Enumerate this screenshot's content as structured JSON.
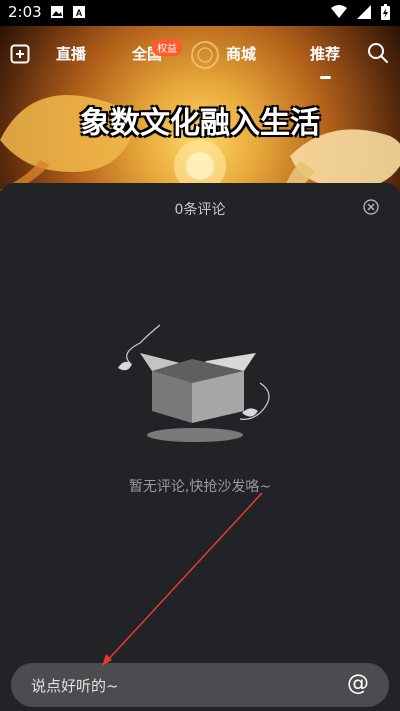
{
  "status_bar": {
    "time": "2:03",
    "icons": [
      "image-icon",
      "a-box-icon"
    ],
    "right_icons": [
      "wifi-icon",
      "signal-icon",
      "battery-charging-icon"
    ]
  },
  "top_nav": {
    "add_icon": "plus-square-icon",
    "tabs": [
      {
        "label": "直播"
      },
      {
        "label": "全国",
        "badge": "权益"
      },
      {
        "label": "商城"
      },
      {
        "label": "推荐",
        "active": true
      }
    ],
    "search_icon": "search-icon"
  },
  "banner": {
    "title": "象数文化融入生活"
  },
  "comments": {
    "title": "0条评论",
    "empty_text": "暂无评论,快抢沙发咯~",
    "input_placeholder": "说点好听的~",
    "at_label": "@"
  },
  "colors": {
    "panel_bg": "#222327",
    "input_bg": "#4c4c50",
    "arrow": "#e53935",
    "badge": "#ff5a2b"
  }
}
